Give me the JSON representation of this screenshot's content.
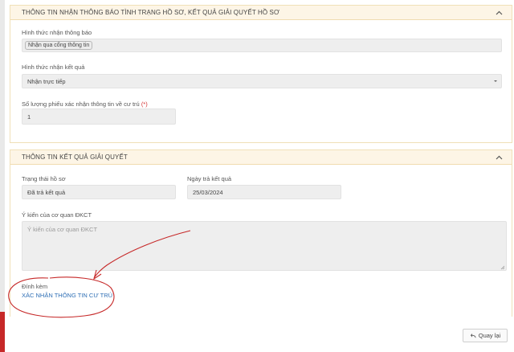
{
  "section1": {
    "title": "THÔNG TIN NHẬN THÔNG BÁO TÌNH TRẠNG HỒ SƠ, KẾT QUẢ GIẢI QUYẾT HỒ SƠ",
    "notify_method_label": "Hình thức nhận thông báo",
    "notify_method_value": "Nhận qua cổng thông tin",
    "result_method_label": "Hình thức nhận kết quả",
    "result_method_value": "Nhận trực tiếp",
    "count_label": "Số lượng phiếu xác nhận thông tin về cư trú",
    "count_required": "(*)",
    "count_value": "1"
  },
  "section2": {
    "title": "THÔNG TIN KẾT QUẢ GIẢI QUYẾT",
    "status_label": "Trạng thái hồ sơ",
    "status_value": "Đã trả kết quả",
    "return_date_label": "Ngày trả kết quả",
    "return_date_value": "25/03/2024",
    "opinion_label": "Ý kiến của cơ quan ĐKCT",
    "opinion_placeholder": "Ý kiến của cơ quan ĐKCT",
    "attachment_label": "Đính kèm",
    "attachment_link": "XÁC NHẬN THÔNG TIN CƯ TRÚ"
  },
  "footer": {
    "back_label": "Quay lại",
    "back_icon": "reply-arrow-icon"
  },
  "colors": {
    "header_bg": "#fdf5e6",
    "link": "#2f6fb5",
    "annotation": "#c62828"
  }
}
